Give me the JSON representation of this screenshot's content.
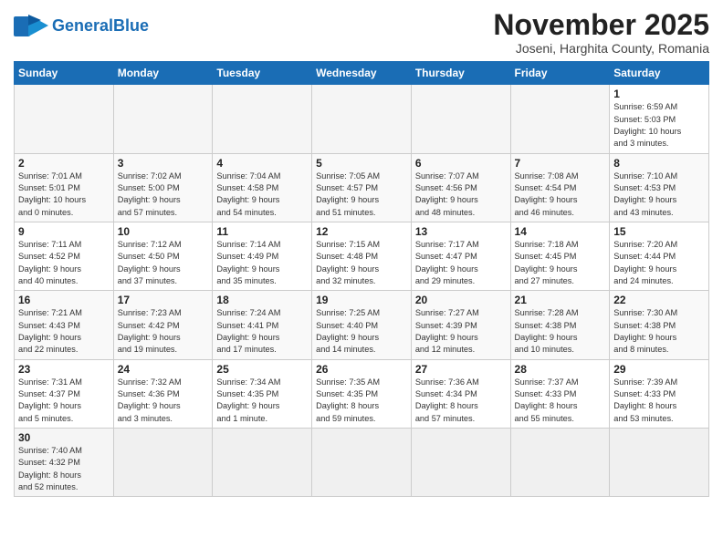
{
  "header": {
    "logo_general": "General",
    "logo_blue": "Blue",
    "month": "November 2025",
    "location": "Joseni, Harghita County, Romania"
  },
  "weekdays": [
    "Sunday",
    "Monday",
    "Tuesday",
    "Wednesday",
    "Thursday",
    "Friday",
    "Saturday"
  ],
  "weeks": [
    [
      {
        "day": "",
        "info": ""
      },
      {
        "day": "",
        "info": ""
      },
      {
        "day": "",
        "info": ""
      },
      {
        "day": "",
        "info": ""
      },
      {
        "day": "",
        "info": ""
      },
      {
        "day": "",
        "info": ""
      },
      {
        "day": "1",
        "info": "Sunrise: 6:59 AM\nSunset: 5:03 PM\nDaylight: 10 hours\nand 3 minutes."
      }
    ],
    [
      {
        "day": "2",
        "info": "Sunrise: 7:01 AM\nSunset: 5:01 PM\nDaylight: 10 hours\nand 0 minutes."
      },
      {
        "day": "3",
        "info": "Sunrise: 7:02 AM\nSunset: 5:00 PM\nDaylight: 9 hours\nand 57 minutes."
      },
      {
        "day": "4",
        "info": "Sunrise: 7:04 AM\nSunset: 4:58 PM\nDaylight: 9 hours\nand 54 minutes."
      },
      {
        "day": "5",
        "info": "Sunrise: 7:05 AM\nSunset: 4:57 PM\nDaylight: 9 hours\nand 51 minutes."
      },
      {
        "day": "6",
        "info": "Sunrise: 7:07 AM\nSunset: 4:56 PM\nDaylight: 9 hours\nand 48 minutes."
      },
      {
        "day": "7",
        "info": "Sunrise: 7:08 AM\nSunset: 4:54 PM\nDaylight: 9 hours\nand 46 minutes."
      },
      {
        "day": "8",
        "info": "Sunrise: 7:10 AM\nSunset: 4:53 PM\nDaylight: 9 hours\nand 43 minutes."
      }
    ],
    [
      {
        "day": "9",
        "info": "Sunrise: 7:11 AM\nSunset: 4:52 PM\nDaylight: 9 hours\nand 40 minutes."
      },
      {
        "day": "10",
        "info": "Sunrise: 7:12 AM\nSunset: 4:50 PM\nDaylight: 9 hours\nand 37 minutes."
      },
      {
        "day": "11",
        "info": "Sunrise: 7:14 AM\nSunset: 4:49 PM\nDaylight: 9 hours\nand 35 minutes."
      },
      {
        "day": "12",
        "info": "Sunrise: 7:15 AM\nSunset: 4:48 PM\nDaylight: 9 hours\nand 32 minutes."
      },
      {
        "day": "13",
        "info": "Sunrise: 7:17 AM\nSunset: 4:47 PM\nDaylight: 9 hours\nand 29 minutes."
      },
      {
        "day": "14",
        "info": "Sunrise: 7:18 AM\nSunset: 4:45 PM\nDaylight: 9 hours\nand 27 minutes."
      },
      {
        "day": "15",
        "info": "Sunrise: 7:20 AM\nSunset: 4:44 PM\nDaylight: 9 hours\nand 24 minutes."
      }
    ],
    [
      {
        "day": "16",
        "info": "Sunrise: 7:21 AM\nSunset: 4:43 PM\nDaylight: 9 hours\nand 22 minutes."
      },
      {
        "day": "17",
        "info": "Sunrise: 7:23 AM\nSunset: 4:42 PM\nDaylight: 9 hours\nand 19 minutes."
      },
      {
        "day": "18",
        "info": "Sunrise: 7:24 AM\nSunset: 4:41 PM\nDaylight: 9 hours\nand 17 minutes."
      },
      {
        "day": "19",
        "info": "Sunrise: 7:25 AM\nSunset: 4:40 PM\nDaylight: 9 hours\nand 14 minutes."
      },
      {
        "day": "20",
        "info": "Sunrise: 7:27 AM\nSunset: 4:39 PM\nDaylight: 9 hours\nand 12 minutes."
      },
      {
        "day": "21",
        "info": "Sunrise: 7:28 AM\nSunset: 4:38 PM\nDaylight: 9 hours\nand 10 minutes."
      },
      {
        "day": "22",
        "info": "Sunrise: 7:30 AM\nSunset: 4:38 PM\nDaylight: 9 hours\nand 8 minutes."
      }
    ],
    [
      {
        "day": "23",
        "info": "Sunrise: 7:31 AM\nSunset: 4:37 PM\nDaylight: 9 hours\nand 5 minutes."
      },
      {
        "day": "24",
        "info": "Sunrise: 7:32 AM\nSunset: 4:36 PM\nDaylight: 9 hours\nand 3 minutes."
      },
      {
        "day": "25",
        "info": "Sunrise: 7:34 AM\nSunset: 4:35 PM\nDaylight: 9 hours\nand 1 minute."
      },
      {
        "day": "26",
        "info": "Sunrise: 7:35 AM\nSunset: 4:35 PM\nDaylight: 8 hours\nand 59 minutes."
      },
      {
        "day": "27",
        "info": "Sunrise: 7:36 AM\nSunset: 4:34 PM\nDaylight: 8 hours\nand 57 minutes."
      },
      {
        "day": "28",
        "info": "Sunrise: 7:37 AM\nSunset: 4:33 PM\nDaylight: 8 hours\nand 55 minutes."
      },
      {
        "day": "29",
        "info": "Sunrise: 7:39 AM\nSunset: 4:33 PM\nDaylight: 8 hours\nand 53 minutes."
      }
    ],
    [
      {
        "day": "30",
        "info": "Sunrise: 7:40 AM\nSunset: 4:32 PM\nDaylight: 8 hours\nand 52 minutes."
      },
      {
        "day": "",
        "info": ""
      },
      {
        "day": "",
        "info": ""
      },
      {
        "day": "",
        "info": ""
      },
      {
        "day": "",
        "info": ""
      },
      {
        "day": "",
        "info": ""
      },
      {
        "day": "",
        "info": ""
      }
    ]
  ]
}
